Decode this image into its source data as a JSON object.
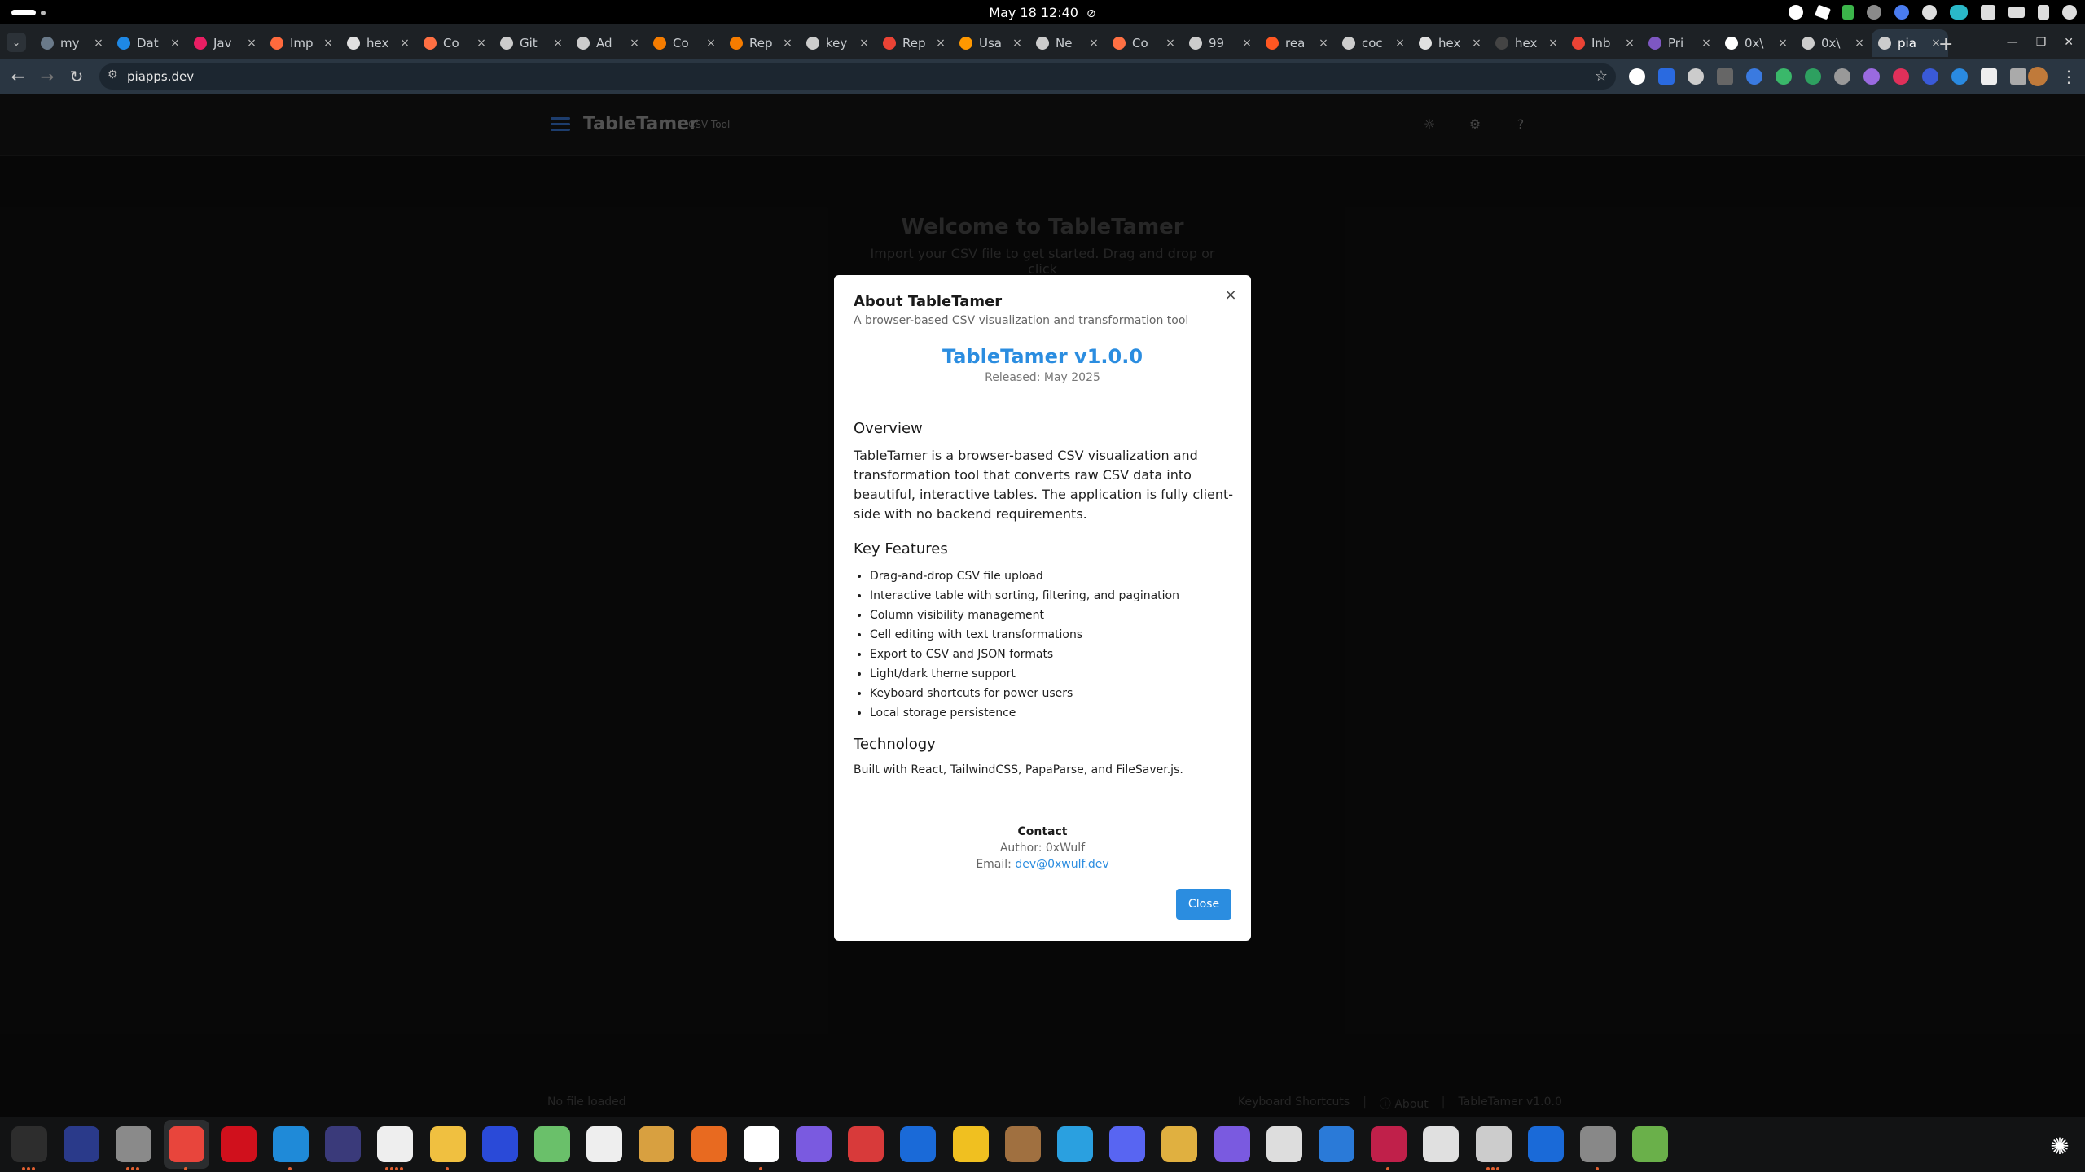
{
  "system": {
    "clock": "May 18  12:40",
    "dnd_glyph": "⊘"
  },
  "browser": {
    "tabs": [
      {
        "label": "my",
        "color": "#6a7a8a"
      },
      {
        "label": "Dat",
        "color": "#1e88e5"
      },
      {
        "label": "Jav",
        "color": "#e91e63"
      },
      {
        "label": "Imp",
        "color": "#ff6a3d"
      },
      {
        "label": "hex",
        "color": "#e0e0e0"
      },
      {
        "label": "Co",
        "color": "#ff7043"
      },
      {
        "label": "Git",
        "color": "#cccccc"
      },
      {
        "label": "Ad",
        "color": "#cccccc"
      },
      {
        "label": "Co",
        "color": "#f57c00"
      },
      {
        "label": "Rep",
        "color": "#f57c00"
      },
      {
        "label": "key",
        "color": "#cccccc"
      },
      {
        "label": "Rep",
        "color": "#ea4335"
      },
      {
        "label": "Usa",
        "color": "#ff9800"
      },
      {
        "label": "Ne",
        "color": "#cccccc"
      },
      {
        "label": "Co",
        "color": "#ff7043"
      },
      {
        "label": "99",
        "color": "#cccccc"
      },
      {
        "label": "rea",
        "color": "#ff5722"
      },
      {
        "label": "coc",
        "color": "#cccccc"
      },
      {
        "label": "hex",
        "color": "#e0e0e0"
      },
      {
        "label": "hex",
        "color": "#444444"
      },
      {
        "label": "Inb",
        "color": "#ea4335"
      },
      {
        "label": "Pri",
        "color": "#7e57c2"
      },
      {
        "label": "0x\\",
        "color": "#ffffff"
      },
      {
        "label": "0x\\",
        "color": "#cccccc"
      },
      {
        "label": "pia",
        "color": "#cccccc",
        "active": true
      }
    ],
    "tab_close_glyph": "×",
    "new_tab_glyph": "+",
    "url": "piapps.dev"
  },
  "app": {
    "title": "TableTamer",
    "subtitle": "CSV Tool",
    "welcome_title": "Welcome to TableTamer",
    "welcome_text": "Import your CSV file to get started. Drag and drop or click",
    "footer": {
      "status": "No file loaded",
      "shortcuts": "Keyboard Shortcuts",
      "about": "About",
      "version": "TableTamer v1.0.0",
      "separator": "|"
    }
  },
  "modal": {
    "title": "About TableTamer",
    "subtitle": "A browser-based CSV visualization and transformation tool",
    "version": "TableTamer v1.0.0",
    "released": "Released: May 2025",
    "overview_heading": "Overview",
    "overview_text": "TableTamer is a browser-based CSV visualization and transformation tool that converts raw CSV data into beautiful, interactive tables. The application is fully client-side with no backend requirements.",
    "features_heading": "Key Features",
    "features": [
      "Drag-and-drop CSV file upload",
      "Interactive table with sorting, filtering, and pagination",
      "Column visibility management",
      "Cell editing with text transformations",
      "Export to CSV and JSON formats",
      "Light/dark theme support",
      "Keyboard shortcuts for power users",
      "Local storage persistence"
    ],
    "technology_heading": "Technology",
    "technology_text": "Built with React, TailwindCSS, PapaParse, and FileSaver.js.",
    "contact_heading": "Contact",
    "author": "Author: 0xWulf",
    "email_label": "Email: ",
    "email": "dev@0xwulf.dev",
    "close_label": "Close",
    "close_x": "×"
  },
  "dock": {
    "apps": [
      {
        "name": "terminal",
        "color": "#2d2d2d"
      },
      {
        "name": "screen-manager",
        "color": "#2a3a8a"
      },
      {
        "name": "files",
        "color": "#8a8a8a"
      },
      {
        "name": "chrome",
        "color": "#e8453c"
      },
      {
        "name": "opera",
        "color": "#d0101c"
      },
      {
        "name": "vscode",
        "color": "#1f8ad8"
      },
      {
        "name": "eclipse",
        "color": "#3a3a7a"
      },
      {
        "name": "typora",
        "color": "#eeeeee"
      },
      {
        "name": "text-editor",
        "color": "#f0c040"
      },
      {
        "name": "intellij",
        "color": "#2a4ad8"
      },
      {
        "name": "box-app",
        "color": "#6ac06a"
      },
      {
        "name": "unity",
        "color": "#eeeeee"
      },
      {
        "name": "sloth",
        "color": "#d8a040"
      },
      {
        "name": "app-center",
        "color": "#e86a20"
      },
      {
        "name": "calendar",
        "color": "#ffffff"
      },
      {
        "name": "mail",
        "color": "#7a5ae0"
      },
      {
        "name": "todo",
        "color": "#d83a3a"
      },
      {
        "name": "password-manager",
        "color": "#1a6ad8"
      },
      {
        "name": "prompt",
        "color": "#f0c020"
      },
      {
        "name": "books",
        "color": "#a07040"
      },
      {
        "name": "telegram",
        "color": "#2aa0e0"
      },
      {
        "name": "discord",
        "color": "#5865f2"
      },
      {
        "name": "game",
        "color": "#e0b040"
      },
      {
        "name": "proton-vpn",
        "color": "#7a5ae0"
      },
      {
        "name": "fedora-media",
        "color": "#dddddd"
      },
      {
        "name": "writer",
        "color": "#2a7ad8"
      },
      {
        "name": "raspberry-pi",
        "color": "#c0204a"
      },
      {
        "name": "document-viewer",
        "color": "#e0e0e0"
      },
      {
        "name": "image-viewer",
        "color": "#cccccc"
      },
      {
        "name": "thunderbird",
        "color": "#1a6ad8"
      },
      {
        "name": "archive",
        "color": "#888888"
      },
      {
        "name": "trash",
        "color": "#6ab04a"
      }
    ]
  }
}
